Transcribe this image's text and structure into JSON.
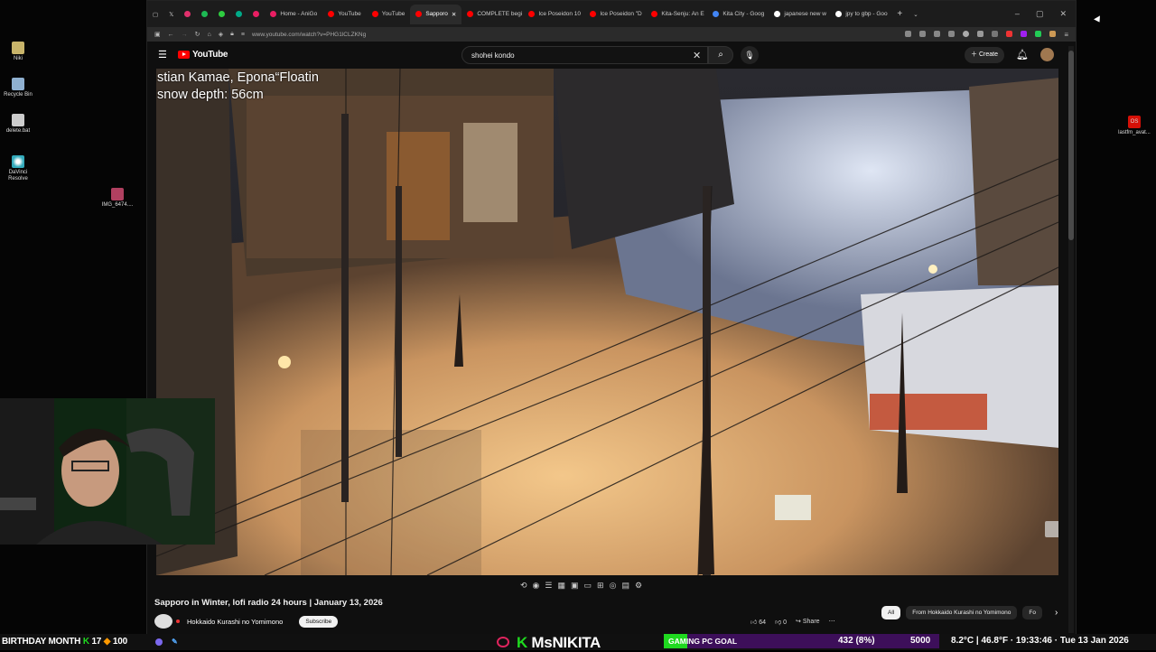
{
  "desktop_icons": [
    {
      "label": "Niki"
    },
    {
      "label": "Recycle Bin"
    },
    {
      "label": "delete.bat"
    },
    {
      "label": "DaVinci Resolve"
    },
    {
      "label": "IMG_6474...."
    }
  ],
  "right_icon": {
    "label": "lastfm_avat..."
  },
  "tabs": [
    {
      "label": "Home - AniGo",
      "color": "#e91e63"
    },
    {
      "label": "YouTube",
      "color": "#f00"
    },
    {
      "label": "YouTube",
      "color": "#f00"
    },
    {
      "label": "Sapporo",
      "color": "#f00",
      "active": true
    },
    {
      "label": "COMPLETE begi",
      "color": "#f00"
    },
    {
      "label": "Ice Poseidon 10",
      "color": "#f00"
    },
    {
      "label": "Ice Poseidon \"D",
      "color": "#f00"
    },
    {
      "label": "Kita-Senju: An E",
      "color": "#f00"
    },
    {
      "label": "Kita City - Goog",
      "color": "#4285f4"
    },
    {
      "label": "japanese new w",
      "color": "#fff"
    },
    {
      "label": "jpy to gbp - Goo",
      "color": "#fff"
    }
  ],
  "url": "www.youtube.com/watch?v=PHG1lCLZKNg",
  "youtube": {
    "logo": "YouTube",
    "search_value": "shohei kondo",
    "create_label": "Create"
  },
  "video": {
    "overlay_line1": "stian Kamae, Epona“Floatin",
    "overlay_line2": "snow depth: 56cm",
    "title": "Sapporo in Winter, lofi radio 24 hours | January 13, 2026",
    "channel": "Hokkaido Kurashi no Yomimono",
    "subscribe_label": "Subscribe",
    "likes": "64",
    "dislikes": "0",
    "share_label": "Share"
  },
  "chips": [
    {
      "label": "All",
      "selected": true
    },
    {
      "label": "From Hokkaido Kurashi no Yomimono"
    },
    {
      "label": "Fo"
    }
  ],
  "taskbar": {
    "birthday_text": "BIRTHDAY MONTH",
    "k_count": "17",
    "hundred": "100",
    "streamer_k": "K",
    "streamer_name": "MsNIKITA",
    "goal_label": "GAMING PC GOAL",
    "goal_progress": "432 (8%)",
    "goal_fraction": 0.086,
    "goal_target": "5000",
    "weather": "8.2°C | 46.8°F · 19:33:46 · Tue 13 Jan 2026"
  }
}
